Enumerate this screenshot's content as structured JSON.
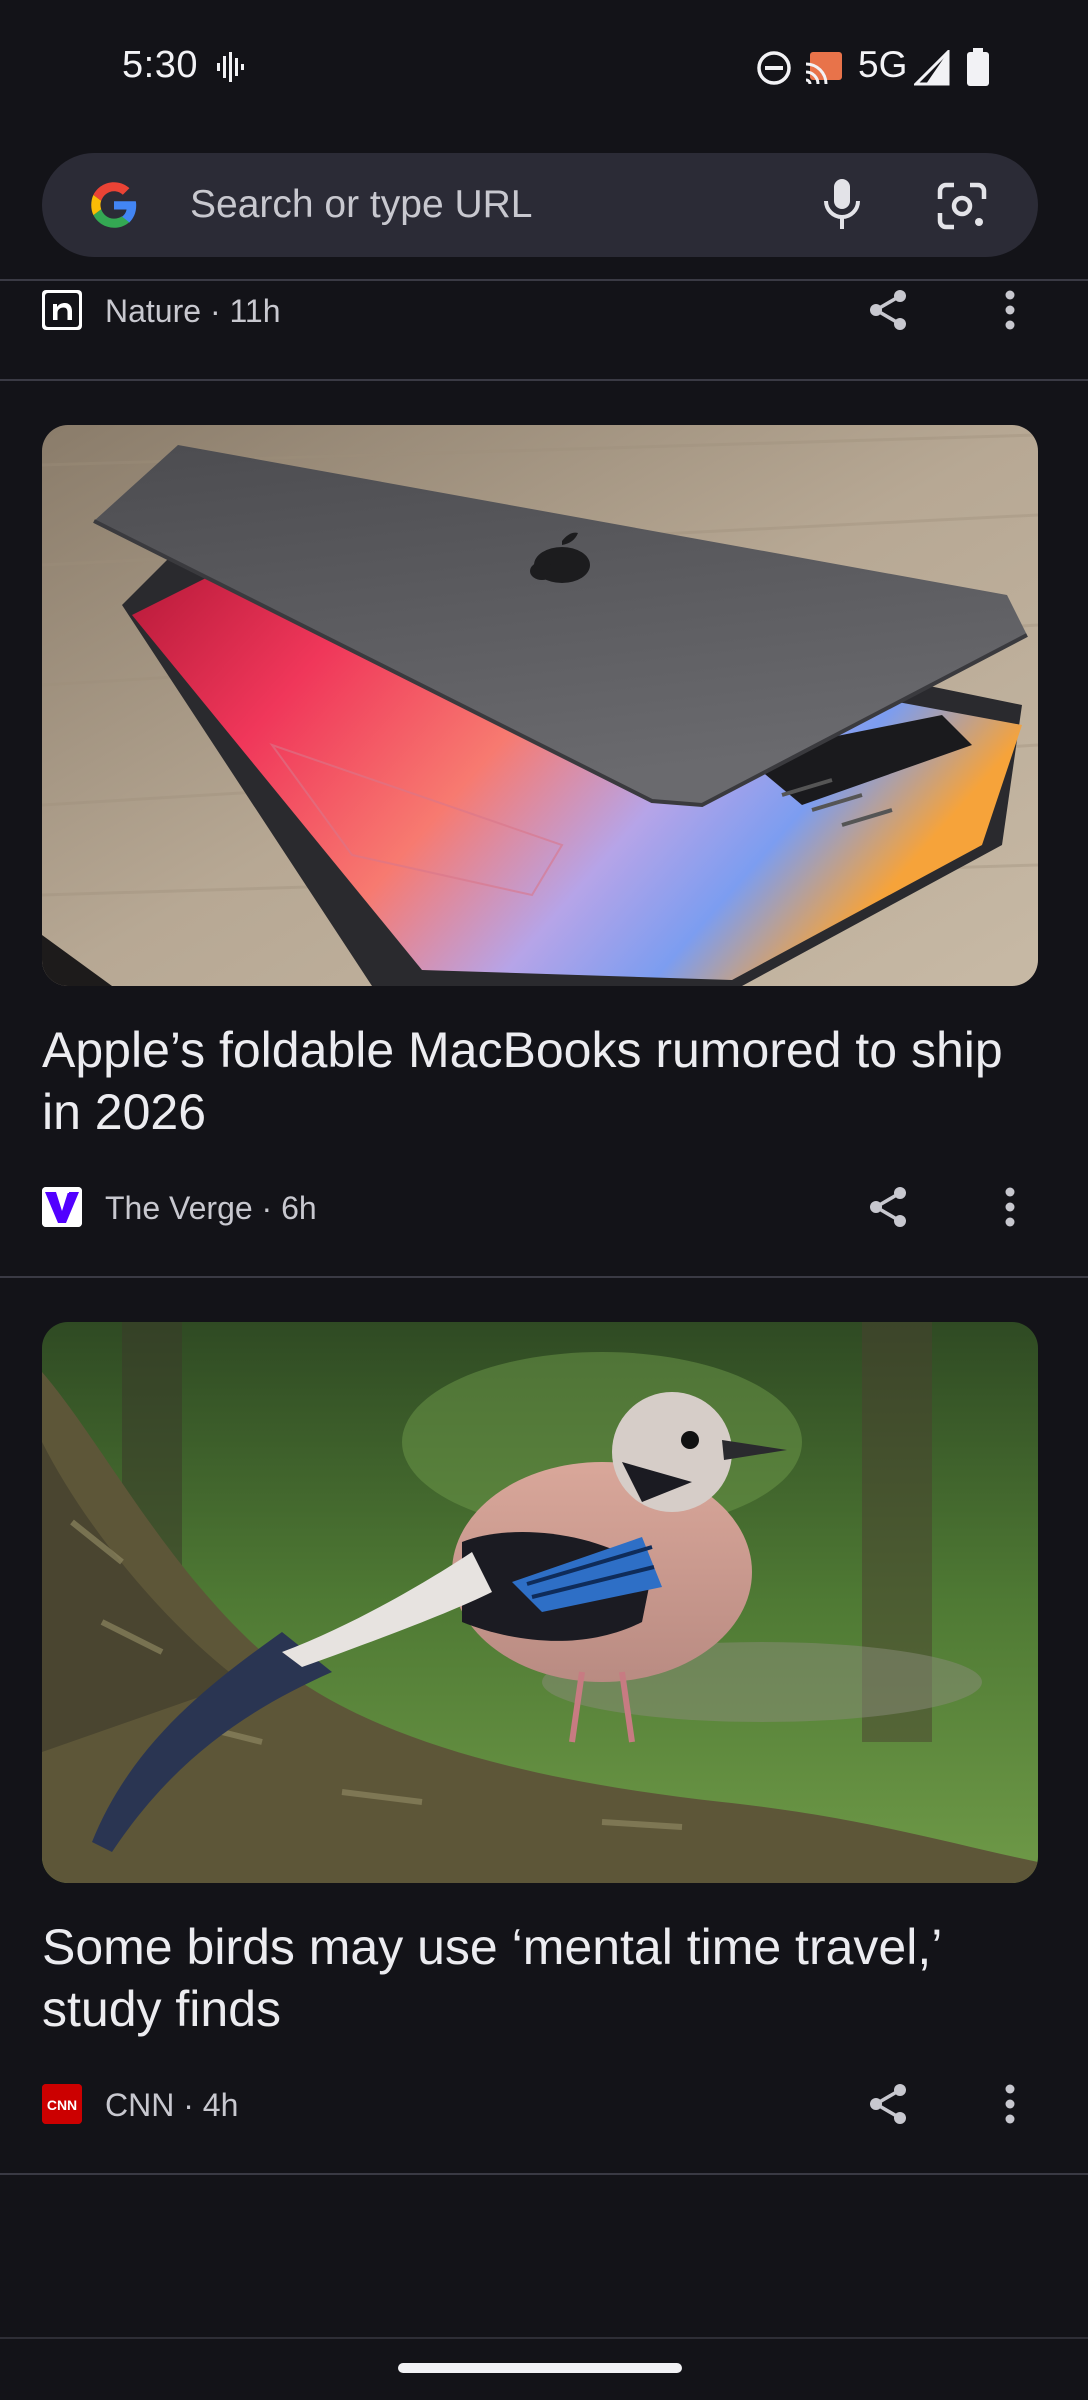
{
  "status_bar": {
    "time": "5:30",
    "network": "5G",
    "icons": [
      "sound-wave-icon",
      "do-not-disturb-icon",
      "cast-icon",
      "signal-icon",
      "battery-icon"
    ]
  },
  "search": {
    "placeholder": "Search or type URL",
    "icons": [
      "google-logo",
      "microphone-icon",
      "lens-camera-icon"
    ]
  },
  "feed": {
    "items": [
      {
        "source": "Nature",
        "time": "11h",
        "meta": "Nature · 11h"
      },
      {
        "title": "Apple’s foldable MacBooks rumored to ship in 2026",
        "source": "The Verge",
        "time": "6h",
        "meta": "The Verge · 6h",
        "image": "laptop-photo"
      },
      {
        "title": "Some birds may use ‘mental time travel,’ study finds",
        "source": "CNN",
        "time": "4h",
        "meta": "CNN · 4h",
        "image": "bird-photo"
      }
    ]
  },
  "colors": {
    "background": "#131318",
    "search_bar": "#2b2b36",
    "divider": "#3a3a44",
    "verge_purple": "#5200ff",
    "cnn_red": "#cc0000"
  }
}
